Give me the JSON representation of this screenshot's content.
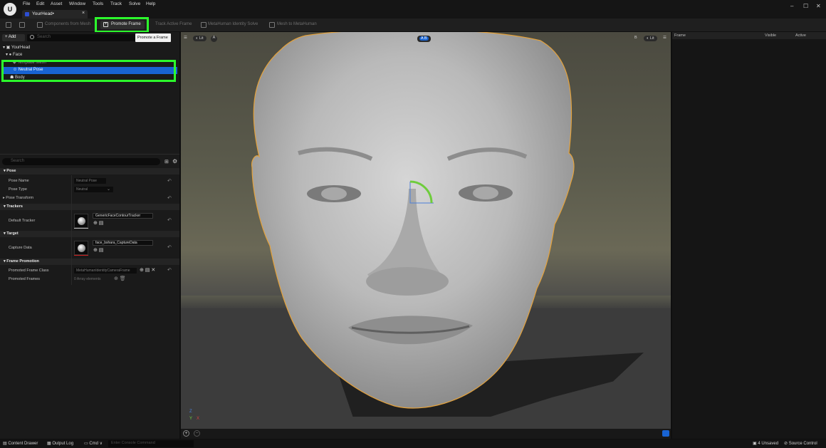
{
  "app": {
    "logo": "U",
    "tab_title": "YourHead•",
    "tab_close": "×"
  },
  "menu": [
    "File",
    "Edit",
    "Asset",
    "Window",
    "Tools",
    "Track",
    "Solve",
    "Help"
  ],
  "window_controls": {
    "minimize": "–",
    "maximize": "☐",
    "close": "✕"
  },
  "toolbar": {
    "components_from_mesh": "Components from Mesh",
    "promote_frame": "Promote Frame",
    "track_active_frame": "Track Active Frame",
    "metahuman_identity_solve": "MetaHuman Identity Solve",
    "mesh_to_metahuman": "Mesh to MetaHuman",
    "tooltip": "Promote a Frame"
  },
  "outliner": {
    "add_label": "+ Add",
    "search_placeholder": "Search",
    "items": [
      "YourHead",
      "Face",
      "Template Mesh",
      "Neutral Pose",
      "Body"
    ]
  },
  "details": {
    "search_placeholder": "Search",
    "sections": {
      "pose": "Pose",
      "trackers": "Trackers",
      "target": "Target",
      "frame_promotion": "Frame Promotion"
    },
    "pose_name_label": "Pose Name",
    "pose_name_value": "Neutral Pose",
    "pose_type_label": "Pose Type",
    "pose_type_value": "Neutral",
    "pose_transform_label": "Pose Transform",
    "default_tracker_label": "Default Tracker",
    "default_tracker_value": "GenericFaceContourTracker",
    "capture_data_label": "Capture Data",
    "capture_data_value": "face_bshara_CaptureData",
    "promoted_frame_class_label": "Promoted Frame Class",
    "promoted_frame_class_value": "MetaHumanIdentityCameraFrame",
    "promoted_frames_label": "Promoted Frames",
    "promoted_frames_value": "0 Array elements"
  },
  "viewport": {
    "lit_label": "Lit",
    "a_label": "A",
    "ab_label": "A B",
    "b_label": "B",
    "lit_right_label": "Lit",
    "axis_z": "Z",
    "axis_y": "Y",
    "axis_x": "X"
  },
  "right_panel": {
    "col_frame": "Frame",
    "col_visible": "Visible",
    "col_active": "Active"
  },
  "statusbar": {
    "content_drawer": "Content Drawer",
    "output_log": "Output Log",
    "cmd": "Cmd ∨",
    "console_placeholder": "Enter Console Command",
    "unsaved": "4 Unsaved",
    "source_control": "Source Control"
  },
  "colors": {
    "highlight": "#2cff2c",
    "selection": "#1863d2",
    "accent_orange": "#e4a23c"
  }
}
